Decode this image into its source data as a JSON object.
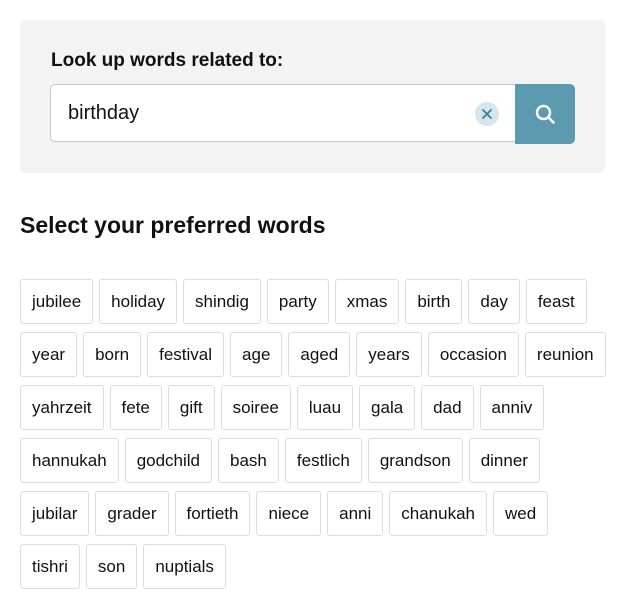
{
  "search": {
    "label": "Look up words related to:",
    "value": "birthday",
    "placeholder": ""
  },
  "results": {
    "heading": "Select your preferred words",
    "words": [
      "jubilee",
      "holiday",
      "shindig",
      "party",
      "xmas",
      "birth",
      "day",
      "feast",
      "year",
      "born",
      "festival",
      "age",
      "aged",
      "years",
      "occasion",
      "reunion",
      "yahrzeit",
      "fete",
      "gift",
      "soiree",
      "luau",
      "gala",
      "dad",
      "anniv",
      "hannukah",
      "godchild",
      "bash",
      "festlich",
      "grandson",
      "dinner",
      "jubilar",
      "grader",
      "fortieth",
      "niece",
      "anni",
      "chanukah",
      "wed",
      "tishri",
      "son",
      "nuptials"
    ]
  },
  "colors": {
    "panel_bg": "#f3f3f3",
    "search_button": "#5b9aaf",
    "clear_button_bg": "#d6e4ec",
    "clear_icon": "#3f7f96",
    "chip_border": "#dddddd"
  },
  "icons": {
    "clear": "close-icon",
    "search": "search-icon"
  }
}
